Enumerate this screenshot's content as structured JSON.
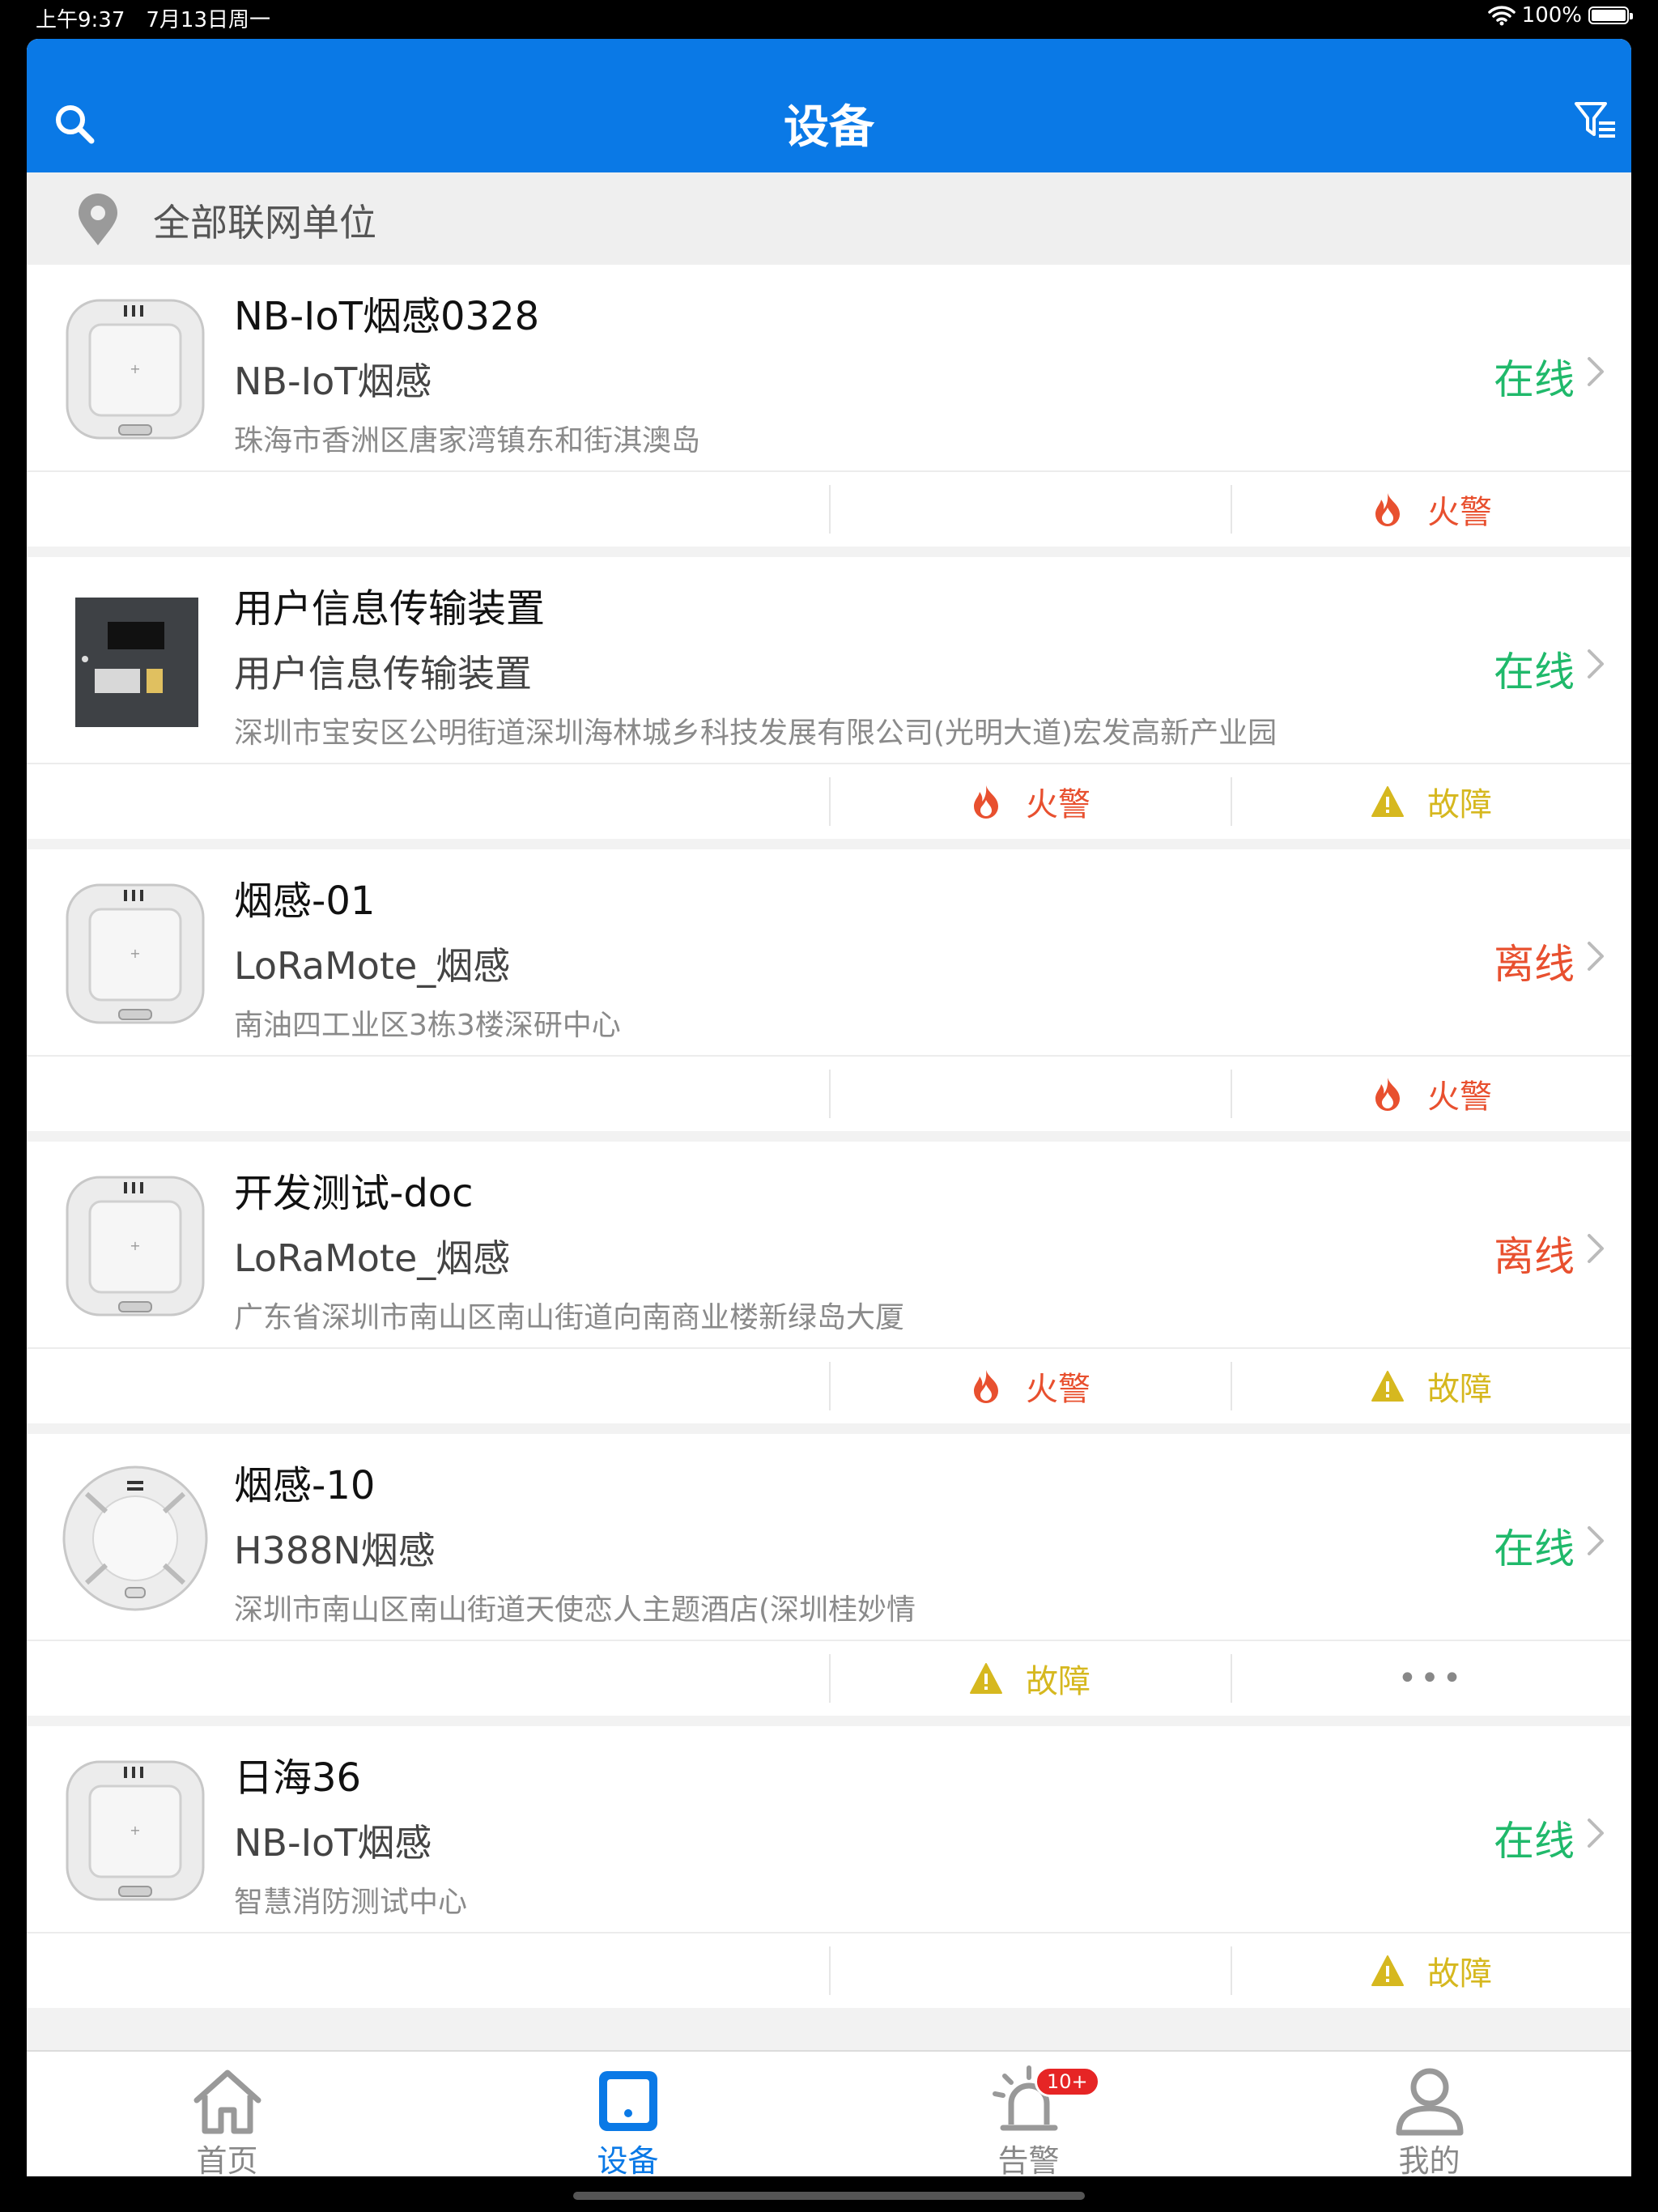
{
  "status_bar": {
    "time": "上午9:37",
    "date": "7月13日周一",
    "battery": "100%"
  },
  "nav": {
    "title": "设备"
  },
  "unit_filter": {
    "label": "全部联网单位"
  },
  "devices": [
    {
      "name": "NB-IoT烟感0328",
      "type": "NB-IoT烟感",
      "address": "珠海市香洲区唐家湾镇东和街淇澳岛",
      "status": "在线",
      "status_kind": "online",
      "thumb": "square-detector",
      "alerts": [
        {
          "label": "火警",
          "kind": "fire"
        }
      ]
    },
    {
      "name": "用户信息传输装置",
      "type": "用户信息传输装置",
      "address": "深圳市宝安区公明街道深圳海林城乡科技发展有限公司(光明大道)宏发高新产业园",
      "status": "在线",
      "status_kind": "online",
      "thumb": "panel-device",
      "alerts": [
        {
          "label": "火警",
          "kind": "fire"
        },
        {
          "label": "故障",
          "kind": "fault"
        }
      ]
    },
    {
      "name": "烟感-01",
      "type": "LoRaMote_烟感",
      "address": "南油四工业区3栋3楼深研中心",
      "status": "离线",
      "status_kind": "offline",
      "thumb": "square-detector",
      "alerts": [
        {
          "label": "火警",
          "kind": "fire"
        }
      ]
    },
    {
      "name": "开发测试-doc",
      "type": "LoRaMote_烟感",
      "address": "广东省深圳市南山区南山街道向南商业楼新绿岛大厦",
      "status": "离线",
      "status_kind": "offline",
      "thumb": "square-detector",
      "alerts": [
        {
          "label": "火警",
          "kind": "fire"
        },
        {
          "label": "故障",
          "kind": "fault"
        }
      ]
    },
    {
      "name": "烟感-10",
      "type": "H388N烟感",
      "address": "深圳市南山区南山街道天使恋人主题酒店(深圳桂妙情",
      "status": "在线",
      "status_kind": "online",
      "thumb": "round-detector",
      "alerts": [
        {
          "label": "故障",
          "kind": "fault"
        },
        {
          "label": "•••",
          "kind": "more"
        }
      ]
    },
    {
      "name": "日海36",
      "type": "NB-IoT烟感",
      "address": "智慧消防测试中心",
      "status": "在线",
      "status_kind": "online",
      "thumb": "square-detector",
      "alerts": [
        {
          "label": "故障",
          "kind": "fault"
        }
      ]
    }
  ],
  "tabs": [
    {
      "label": "首页",
      "icon": "home-icon",
      "active": false
    },
    {
      "label": "设备",
      "icon": "device-icon",
      "active": true
    },
    {
      "label": "告警",
      "icon": "alarm-icon",
      "active": false,
      "badge": "10+"
    },
    {
      "label": "我的",
      "icon": "user-icon",
      "active": false
    }
  ],
  "colors": {
    "brand": "#0a79e6",
    "online": "#20b96b",
    "offline": "#e8502f",
    "fire": "#e8502f",
    "fault": "#d6b81f"
  }
}
